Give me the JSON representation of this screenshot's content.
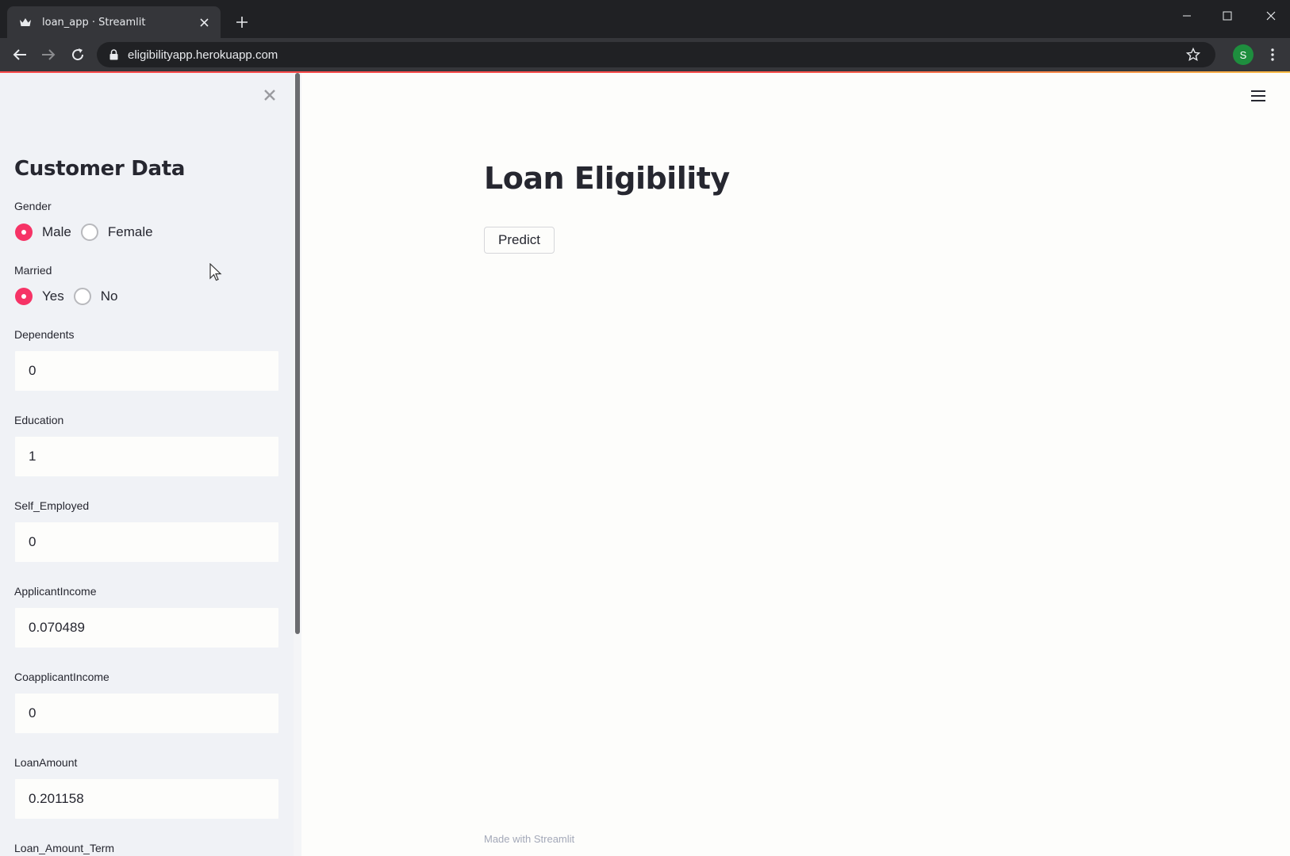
{
  "browser": {
    "tab_title": "loan_app · Streamlit",
    "url": "eligibilityapp.herokuapp.com",
    "profile_initial": "S",
    "accent_color": "#f63366",
    "profile_color": "#1e8e3e"
  },
  "sidebar": {
    "title": "Customer Data",
    "gender": {
      "label": "Gender",
      "options": [
        "Male",
        "Female"
      ],
      "selected": "Male"
    },
    "married": {
      "label": "Married",
      "options": [
        "Yes",
        "No"
      ],
      "selected": "Yes"
    },
    "fields": [
      {
        "label": "Dependents",
        "value": "0"
      },
      {
        "label": "Education",
        "value": "1"
      },
      {
        "label": "Self_Employed",
        "value": "0"
      },
      {
        "label": "ApplicantIncome",
        "value": "0.070489"
      },
      {
        "label": "CoapplicantIncome",
        "value": "0"
      },
      {
        "label": "LoanAmount",
        "value": "0.201158"
      },
      {
        "label": "Loan_Amount_Term",
        "value": ""
      }
    ]
  },
  "main": {
    "title": "Loan Eligibility",
    "predict_label": "Predict",
    "footer": "Made with Streamlit"
  },
  "icons": [
    "streamlit-crown-icon",
    "close-icon",
    "plus-icon",
    "minimize-icon",
    "maximize-icon",
    "back-icon",
    "forward-icon",
    "reload-icon",
    "lock-icon",
    "star-icon",
    "kebab-menu-icon",
    "hamburger-menu-icon",
    "mouse-cursor-icon"
  ]
}
